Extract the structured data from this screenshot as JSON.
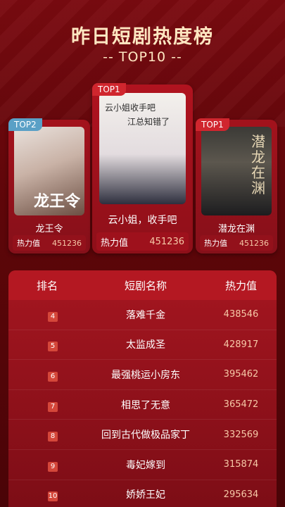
{
  "header": {
    "title": "昨日短剧热度榜",
    "subtitle": "-- TOP10 --"
  },
  "podium": {
    "left": {
      "badge": "TOP2",
      "poster_calligraphy": "龙王令",
      "name": "龙王令",
      "heat_label": "热力值",
      "heat_value": "451236"
    },
    "center": {
      "badge": "TOP1",
      "poster_text_1": "云小姐收手吧",
      "poster_text_2": "江总知错了",
      "name": "云小姐，收手吧",
      "heat_label": "热力值",
      "heat_value": "451236"
    },
    "right": {
      "badge": "TOP1",
      "poster_calligraphy": "潜龙在渊",
      "name": "潜龙在渊",
      "heat_label": "热力值",
      "heat_value": "451236"
    }
  },
  "table": {
    "headers": {
      "rank": "排名",
      "name": "短剧名称",
      "heat": "热力值"
    },
    "rows": [
      {
        "rank": "4",
        "name": "落难千金",
        "heat": "438546"
      },
      {
        "rank": "5",
        "name": "太监成圣",
        "heat": "428917"
      },
      {
        "rank": "6",
        "name": "最强桃运小房东",
        "heat": "395462"
      },
      {
        "rank": "7",
        "name": "相思了无意",
        "heat": "365472"
      },
      {
        "rank": "8",
        "name": "回到古代做极品家丁",
        "heat": "332569"
      },
      {
        "rank": "9",
        "name": "毒妃嫁到",
        "heat": "315874"
      },
      {
        "rank": "10",
        "name": "娇娇王妃",
        "heat": "295634"
      }
    ]
  }
}
